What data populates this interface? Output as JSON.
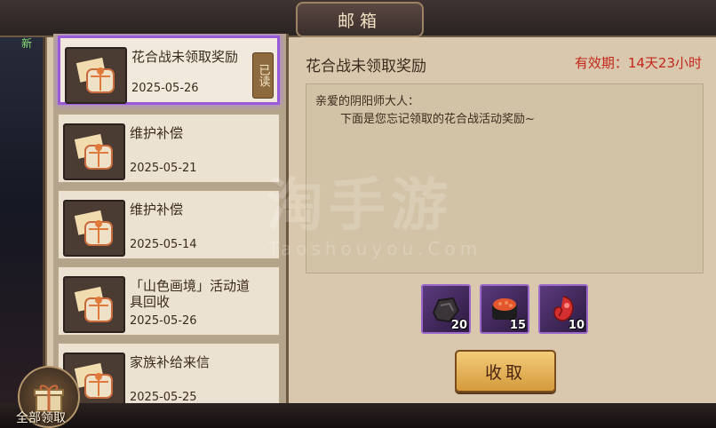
{
  "window": {
    "title": "邮箱"
  },
  "mails": [
    {
      "title": "花合战未领取奖励",
      "date": "2025-05-26",
      "read_label": "已读",
      "selected": true
    },
    {
      "title": "维护补偿",
      "date": "2025-05-21"
    },
    {
      "title": "维护补偿",
      "date": "2025-05-14"
    },
    {
      "title": "「山色画境」活动道具回收",
      "date": "2025-05-26"
    },
    {
      "title": "家族补给来信",
      "date": "2025-05-25"
    }
  ],
  "detail": {
    "title": "花合战未领取奖励",
    "expiry": "有效期：14天23小时",
    "greeting": "亲爱的阴阳师大人：",
    "message": "下面是您忘记领取的花合战活动奖励~"
  },
  "rewards": [
    {
      "name": "stone-item-icon",
      "count": "20"
    },
    {
      "name": "sushi-item-icon",
      "count": "15"
    },
    {
      "name": "red-spirit-item-icon",
      "count": "10"
    }
  ],
  "actions": {
    "collect": "收取",
    "claim_all": "全部领取"
  },
  "watermark": {
    "main": "淘手游",
    "sub": "Taoshouyou.Com"
  },
  "side": {
    "new_label": "新"
  },
  "colors": {
    "accent": "#9a5bd8",
    "expiry": "#c4261b",
    "button": "#e6b25a"
  }
}
